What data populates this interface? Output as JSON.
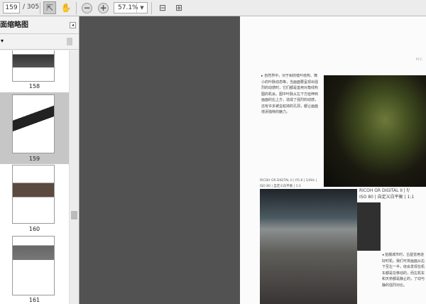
{
  "toolbar": {
    "current_page": "159",
    "total_pages": "/ 305",
    "zoom": "57.1%",
    "icons": [
      "select-tool-icon",
      "hand-tool-icon",
      "zoom-out-icon",
      "zoom-in-icon",
      "fit-page-icon",
      "fit-width-icon"
    ]
  },
  "sidebar": {
    "title": "页面缩略图",
    "options": "▾",
    "thumbnails": [
      {
        "label": "158"
      },
      {
        "label": "159",
        "selected": true
      },
      {
        "label": "160"
      },
      {
        "label": "161"
      }
    ]
  },
  "page": {
    "header": "P.F.C.",
    "paragraph": "自然界中，对于树的枝叶结构、微小的叶脉动态等，当画面要呈现出强烈的动感时，它们都是善用对角线构图的机会。图中叶脉从左下方延伸到画面的右上方，造成了强烈的动感，还有许多被虫蛀掉的孔洞，都让画面增添独特的魅力。",
    "caption1_line1": "RICOH GR DIGITAL II | f/5.6 | 1/40s |",
    "caption1_line2": "ISO 80 | 自定义白平衡 | 1:1",
    "caption2_line1": "RICOH GR DIGITAL II | f/",
    "caption2_line2": "ISO 80 | 自定义白平衡 | 1:1",
    "bottom_text": "拍摄城市时，古屋曾用进好时机，我们可将画面从右下至左一半，绕会发现在机车都是在移动的，而左机车和天桥都是静止的，了动与静的强烈对比。"
  }
}
